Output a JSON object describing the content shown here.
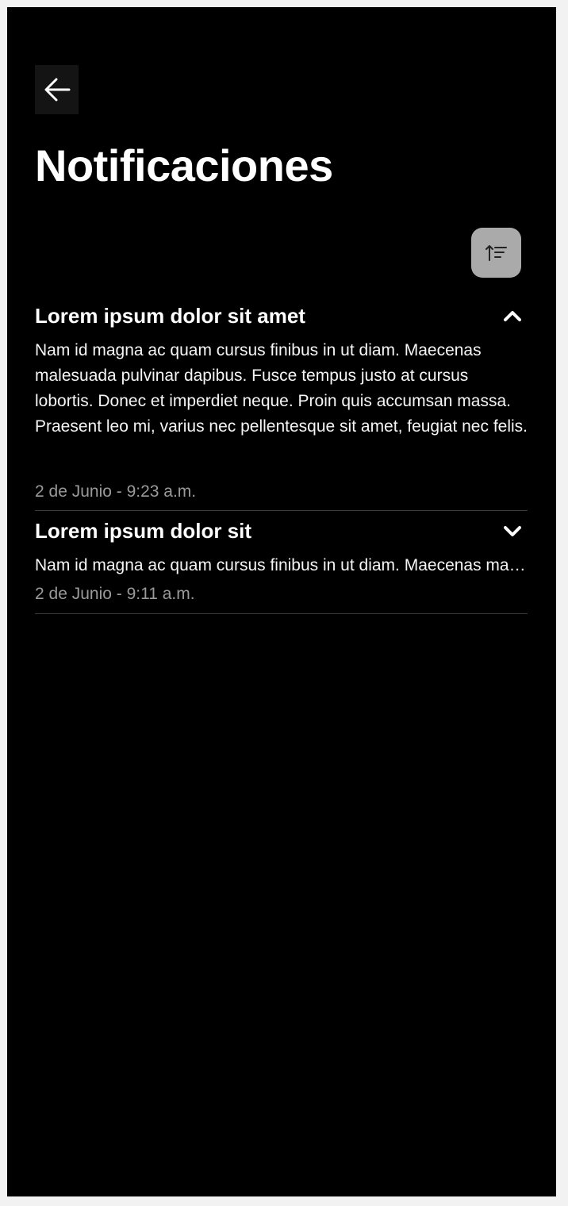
{
  "header": {
    "back_icon": "arrow-left-icon",
    "title": "Notificaciones",
    "sort_icon": "sort-ascending-icon"
  },
  "notifications": [
    {
      "title": "Lorem ipsum dolor sit amet",
      "body": "Nam id magna ac quam cursus finibus in ut diam. Maecenas malesuada pulvinar dapibus. Fusce tempus justo at cursus lobortis. Donec et imperdiet neque. Proin quis accumsan massa. Praesent leo mi, varius nec pellentesque sit amet, feugiat nec felis.",
      "time": "2 de Junio - 9:23 a.m.",
      "expanded": true,
      "toggle_icon": "chevron-up-icon"
    },
    {
      "title": "Lorem ipsum dolor sit",
      "body": "Nam id magna ac quam cursus finibus in ut diam. Maecenas malesuada pulvinar dapibus.",
      "time": "2 de Junio - 9:11 a.m.",
      "expanded": false,
      "toggle_icon": "chevron-down-icon"
    }
  ],
  "colors": {
    "background": "#000000",
    "text": "#ffffff",
    "muted_text": "#9a9a9a",
    "sort_button": "#aaaaaa",
    "divider": "#3a3a3a"
  }
}
